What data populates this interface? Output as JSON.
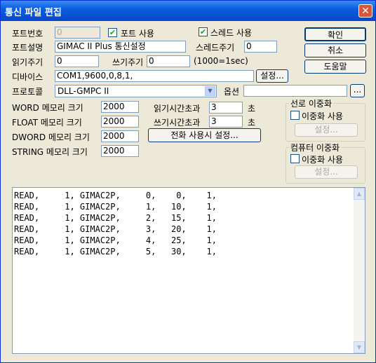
{
  "window": {
    "title": "통신 파일 편집",
    "close_label": "✕"
  },
  "port": {
    "number_label": "포트번호",
    "number_value": "0",
    "use_port_label": "포트 사용",
    "use_port_checked": "✔",
    "use_thread_label": "스레드 사용",
    "use_thread_checked": "✔",
    "desc_label": "포트설명",
    "desc_value": "GIMAC II Plus 통신설정",
    "thread_period_label": "스레드주기",
    "thread_period_value": "0",
    "read_period_label": "읽기주기",
    "read_period_value": "0",
    "write_period_label": "쓰기주기",
    "write_period_value": "0",
    "period_unit": "(1000=1sec)"
  },
  "device": {
    "label": "디바이스",
    "value": "COM1,9600,0,8,1,",
    "settings_button": "설정..."
  },
  "protocol": {
    "label": "프로토콜",
    "selected": "DLL-GMPC II",
    "option_label": "옵션",
    "option_value": "",
    "option_button": "..."
  },
  "memory": {
    "word_label": "WORD 메모리 크기",
    "word_value": "2000",
    "float_label": "FLOAT 메모리 크기",
    "float_value": "2000",
    "dword_label": "DWORD 메모리 크기",
    "dword_value": "2000",
    "string_label": "STRING 메모리 크기",
    "string_value": "2000"
  },
  "timeouts": {
    "read_label": "읽기시간초과",
    "read_value": "3",
    "read_unit": "초",
    "write_label": "쓰기시간초과",
    "write_value": "3",
    "write_unit": "초",
    "phone_button": "전화 사용시 설정..."
  },
  "buttons": {
    "ok": "확인",
    "cancel": "취소",
    "help": "도움말"
  },
  "line_redundancy": {
    "title": "선로 이중화",
    "use_label": "이중화 사용",
    "settings_button": "설정..."
  },
  "computer_redundancy": {
    "title": "컴퓨터 이중화",
    "use_label": "이중화 사용",
    "settings_button": "설정..."
  },
  "commands": [
    "READ,     1, GIMAC2P,     0,    0,    1,",
    "READ,     1, GIMAC2P,     1,   10,    1,",
    "READ,     1, GIMAC2P,     2,   15,    1,",
    "READ,     1, GIMAC2P,     3,   20,    1,",
    "READ,     1, GIMAC2P,     4,   25,    1,",
    "READ,     1, GIMAC2P,     5,   30,    1,"
  ],
  "scrollbar": {
    "up_icon": "▲",
    "down_icon": "▼"
  }
}
